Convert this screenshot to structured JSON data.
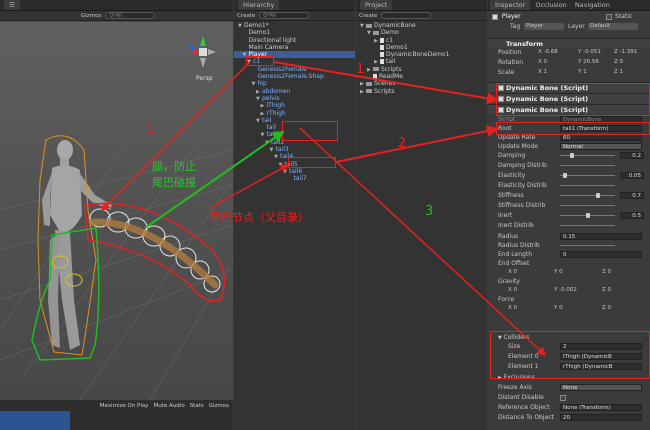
{
  "scene": {
    "gizmos_label": "Gizmos",
    "search_placeholder": "Q*All",
    "persp_label": "Persp",
    "game_bar": [
      "Maximize On Play",
      "Mute Audio",
      "Stats",
      "Gizmos"
    ]
  },
  "hierarchy": {
    "tab": "Hierarchy",
    "create": "Create",
    "search": "Q*All",
    "rows": [
      {
        "label": "Demo1*",
        "indent": 0,
        "arrow": "▼",
        "style": "plain"
      },
      {
        "label": "Demo1",
        "indent": 1,
        "arrow": "",
        "style": "plain"
      },
      {
        "label": "Directional light",
        "indent": 1,
        "arrow": "",
        "style": "plain"
      },
      {
        "label": "Main Camera",
        "indent": 1,
        "arrow": "",
        "style": "plain"
      },
      {
        "label": "Player",
        "indent": 1,
        "arrow": "▼",
        "style": "sel"
      },
      {
        "label": "c1",
        "indent": 2,
        "arrow": "▼",
        "style": "blue"
      },
      {
        "label": "Genesis2Female",
        "indent": 3,
        "arrow": "",
        "style": "blue"
      },
      {
        "label": "Genesis2Female.Shap",
        "indent": 3,
        "arrow": "",
        "style": "blue"
      },
      {
        "label": "hip",
        "indent": 3,
        "arrow": "▼",
        "style": "blue"
      },
      {
        "label": "abdomen",
        "indent": 4,
        "arrow": "▶",
        "style": "blue"
      },
      {
        "label": "pelvis",
        "indent": 4,
        "arrow": "▼",
        "style": "blue"
      },
      {
        "label": "lThigh",
        "indent": 5,
        "arrow": "▶",
        "style": "blue"
      },
      {
        "label": "rThigh",
        "indent": 5,
        "arrow": "▶",
        "style": "blue"
      },
      {
        "label": "tail",
        "indent": 4,
        "arrow": "▼",
        "style": "blue"
      },
      {
        "label": "tail",
        "indent": 5,
        "arrow": "",
        "style": "blue"
      },
      {
        "label": "tail1",
        "indent": 5,
        "arrow": "▼",
        "style": "blue"
      },
      {
        "label": "tail2",
        "indent": 6,
        "arrow": "▼",
        "style": "blue"
      },
      {
        "label": "tail3",
        "indent": 7,
        "arrow": "▼",
        "style": "blue"
      },
      {
        "label": "tail4",
        "indent": 8,
        "arrow": "▼",
        "style": "blue"
      },
      {
        "label": "tail5",
        "indent": 9,
        "arrow": "▼",
        "style": "blue"
      },
      {
        "label": "tail6",
        "indent": 10,
        "arrow": "▼",
        "style": "blue"
      },
      {
        "label": "tail7",
        "indent": 11,
        "arrow": "",
        "style": "blue"
      }
    ]
  },
  "project": {
    "tab": "Project",
    "create": "Create",
    "rows": [
      {
        "label": "DynamicBone",
        "indent": 0,
        "arrow": "▼",
        "icon": "folder"
      },
      {
        "label": "Demo",
        "indent": 1,
        "arrow": "▼",
        "icon": "folder"
      },
      {
        "label": "c1",
        "indent": 2,
        "arrow": "▶",
        "icon": "file"
      },
      {
        "label": "Demo1",
        "indent": 2,
        "arrow": "",
        "icon": "file"
      },
      {
        "label": "DynamicBoneDemo1",
        "indent": 2,
        "arrow": "",
        "icon": "file"
      },
      {
        "label": "tail",
        "indent": 2,
        "arrow": "▶",
        "icon": "file"
      },
      {
        "label": "Scripts",
        "indent": 1,
        "arrow": "▶",
        "icon": "folder"
      },
      {
        "label": "ReadMe",
        "indent": 1,
        "arrow": "",
        "icon": "file"
      },
      {
        "label": "Scenes",
        "indent": 0,
        "arrow": "▶",
        "icon": "folder"
      },
      {
        "label": "Scripts",
        "indent": 0,
        "arrow": "▶",
        "icon": "folder"
      }
    ]
  },
  "inspector": {
    "tabs": [
      "Inspector",
      "Occlusion",
      "Navigation"
    ],
    "object_name": "Player",
    "static_label": "Static",
    "tag_label": "Tag",
    "tag_value": "Player",
    "layer_label": "Layer",
    "layer_value": "Default",
    "transform_title": "Transform",
    "position": {
      "label": "Position",
      "x": "-0.68",
      "y": "-0.051",
      "z": "-1.391"
    },
    "rotation": {
      "label": "Rotation",
      "x": "0",
      "y": "26.56",
      "z": "0"
    },
    "scale": {
      "label": "Scale",
      "x": "1",
      "y": "1",
      "z": "1"
    },
    "components": [
      "Dynamic Bone (Script)",
      "Dynamic Bone (Script)",
      "Dynamic Bone (Script)"
    ],
    "script_label": "Script",
    "script_value": "DynamicBone",
    "root_label": "Root",
    "root_value": "tail1 (Transform)",
    "update_rate_label": "Update Rate",
    "update_rate_value": "60",
    "update_mode_label": "Update Mode",
    "update_mode_value": "Normal",
    "sliders": [
      {
        "label": "Damping",
        "value": "0.2",
        "pos": 0.2
      },
      {
        "label": "Damping Distrib",
        "value": "",
        "pos": null
      },
      {
        "label": "Elasticity",
        "value": "0.05",
        "pos": 0.05
      },
      {
        "label": "Elasticity Distrib",
        "value": "",
        "pos": null
      },
      {
        "label": "Stiffness",
        "value": "0.7",
        "pos": 0.7
      },
      {
        "label": "Stiffness Distrib",
        "value": "",
        "pos": null
      },
      {
        "label": "Inert",
        "value": "0.5",
        "pos": 0.5
      },
      {
        "label": "Inert Distrib",
        "value": "",
        "pos": null
      }
    ],
    "radius_label": "Radius",
    "radius_value": "0.15",
    "radius_distrib_label": "Radius Distrib",
    "end_length_label": "End Length",
    "end_length_value": "0",
    "end_offset_label": "End Offset",
    "end_offset": {
      "x": "0",
      "y": "0",
      "z": "0"
    },
    "gravity_label": "Gravity",
    "gravity": {
      "x": "0",
      "y": "-0.002",
      "z": "0"
    },
    "force_label": "Force",
    "force": {
      "x": "0",
      "y": "0",
      "z": "0"
    },
    "colliders_label": "Colliders",
    "size_label": "Size",
    "size_value": "2",
    "element0_label": "Element 0",
    "element0_value": "lThigh (DynamicB",
    "element1_label": "Element 1",
    "element1_value": "rThigh (DynamicB",
    "exclusions_label": "Exclusions",
    "freeze_axis_label": "Freeze Axis",
    "freeze_axis_value": "None",
    "distant_disable_label": "Distant Disable",
    "reference_object_label": "Reference Object",
    "reference_object_value": "None (Transform)",
    "distance_to_object_label": "Distance To Object",
    "distance_to_object_value": "20"
  },
  "annotations": {
    "num1a": "1",
    "num1b": "1",
    "num2": "2",
    "num3": "3",
    "green_text_1": "腿，防止",
    "green_text_2": "尾巴碰撞",
    "red_text": "尾巴节点（父目录）",
    "colors": {
      "red": "#e82020",
      "green": "#22bb22",
      "selection": "#3e5e9a"
    }
  }
}
